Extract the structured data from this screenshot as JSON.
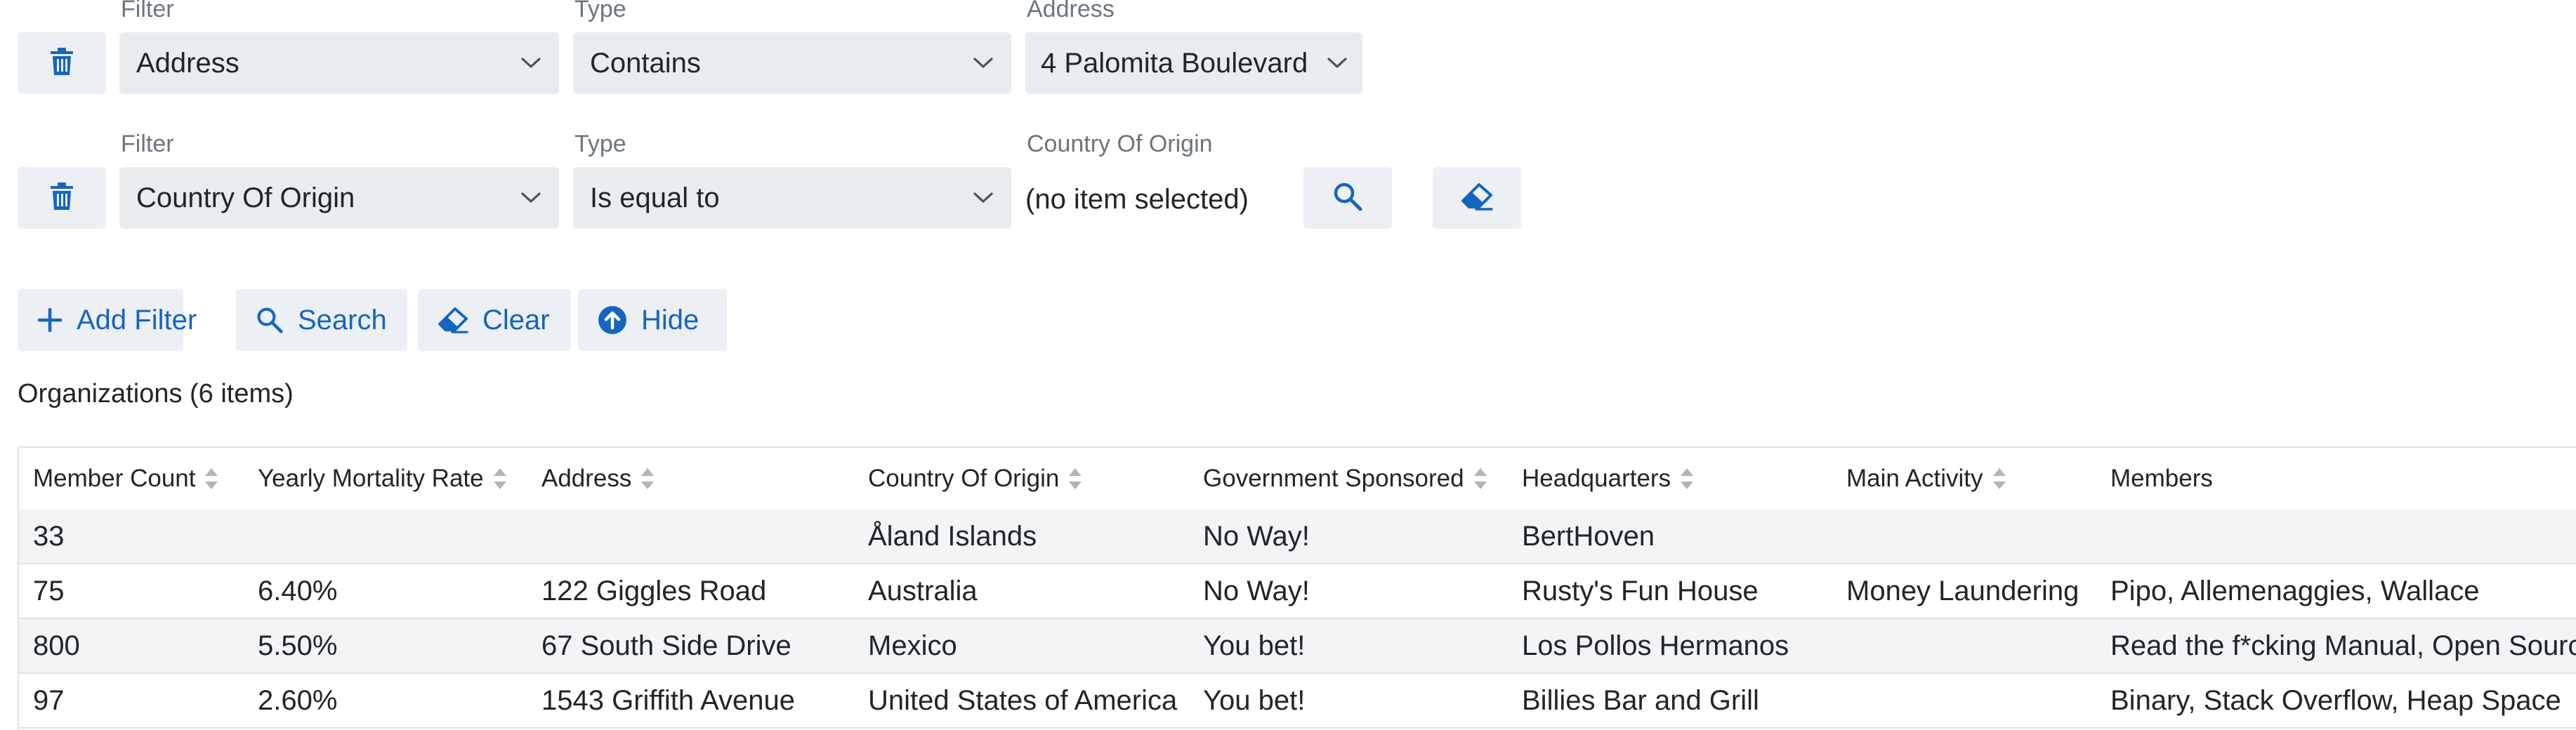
{
  "filters": [
    {
      "filter_label": "Filter",
      "filter_value": "Address",
      "type_label": "Type",
      "type_value": "Contains",
      "value_label": "Address",
      "value_value": "4 Palomita Boulevard"
    },
    {
      "filter_label": "Filter",
      "filter_value": "Country Of Origin",
      "type_label": "Type",
      "type_value": "Is equal to",
      "value_label": "Country Of Origin",
      "value_value": "(no item selected)"
    }
  ],
  "toolbar": {
    "add_filter": "Add Filter",
    "search": "Search",
    "clear": "Clear",
    "hide": "Hide"
  },
  "table": {
    "title": "Organizations (6 items)",
    "columns": [
      "Member Count",
      "Yearly Mortality Rate",
      "Address",
      "Country Of Origin",
      "Government Sponsored",
      "Headquarters",
      "Main Activity",
      "Members"
    ],
    "rows": [
      [
        "33",
        "",
        "",
        "Åland Islands",
        "No Way!",
        "BertHoven",
        "",
        ""
      ],
      [
        "75",
        "6.40%",
        "122 Giggles Road",
        "Australia",
        "No Way!",
        "Rusty's Fun House",
        "Money Laundering",
        "Pipo, Allemenaggies, Wallace"
      ],
      [
        "800",
        "5.50%",
        "67 South Side Drive",
        "Mexico",
        "You bet!",
        "Los Pollos Hermanos",
        "",
        "Read the f*cking Manual, Open Source"
      ],
      [
        "97",
        "2.60%",
        "1543 Griffith Avenue",
        "United States of America",
        "You bet!",
        "Billies Bar and Grill",
        "",
        "Binary, Stack Overflow, Heap Space"
      ]
    ]
  },
  "colors": {
    "accent": "#1565c0",
    "button_bg": "#eceff3",
    "select_bg": "#e9ecef",
    "row_alt": "#f3f4f6",
    "border": "#dee2e6"
  }
}
